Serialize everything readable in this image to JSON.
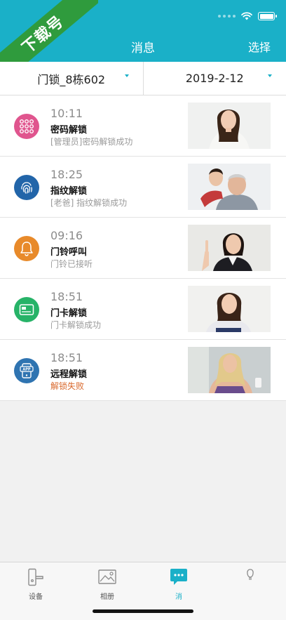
{
  "header": {
    "title": "消息",
    "select_label": "选择"
  },
  "watermark": {
    "text": "下载号"
  },
  "filters": {
    "lock": "门锁_8栋602",
    "date": "2019-2-12"
  },
  "records": [
    {
      "time": "10:11",
      "type": "密码解锁",
      "detail": "[管理员]密码解锁成功",
      "status": "success",
      "icon": "keypad-icon",
      "color": "#e0558e"
    },
    {
      "time": "18:25",
      "type": "指纹解锁",
      "detail": "[老爸] 指纹解锁成功",
      "status": "success",
      "icon": "fingerprint-icon",
      "color": "#2265a9"
    },
    {
      "time": "09:16",
      "type": "门铃呼叫",
      "detail": "门铃已接听",
      "status": "success",
      "icon": "bell-icon",
      "color": "#e88a2a"
    },
    {
      "time": "18:51",
      "type": "门卡解锁",
      "detail": "门卡解锁成功",
      "status": "success",
      "icon": "card-icon",
      "color": "#27b368"
    },
    {
      "time": "18:51",
      "type": "远程解锁",
      "detail": "解锁失败",
      "status": "fail",
      "icon": "app-icon",
      "color": "#2f74b1"
    }
  ],
  "tabs": [
    {
      "label": "设备",
      "icon": "lock-device-icon",
      "active": false
    },
    {
      "label": "相册",
      "icon": "album-icon",
      "active": false
    },
    {
      "label": "消",
      "icon": "message-icon",
      "active": true
    },
    {
      "label": "",
      "icon": "profile-icon",
      "active": false
    }
  ],
  "colors": {
    "accent": "#1ab0c8",
    "fail": "#d9692d"
  }
}
